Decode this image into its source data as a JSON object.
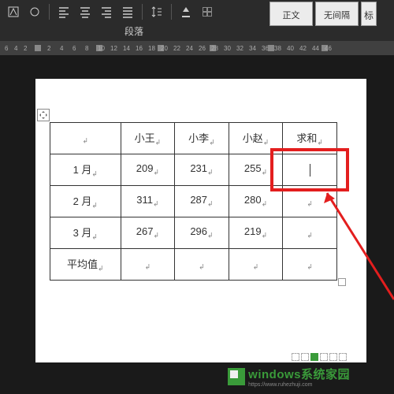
{
  "ribbon": {
    "section_label": "段落",
    "styles": {
      "normal": "正文",
      "no_spacing": "无间隔",
      "heading_partial": "标"
    }
  },
  "ruler": {
    "marks": [
      "6",
      "4",
      "2",
      "2",
      "4",
      "6",
      "8",
      "10",
      "12",
      "14",
      "16",
      "18",
      "20",
      "22",
      "24",
      "26",
      "28",
      "30",
      "32",
      "34",
      "36",
      "38",
      "40",
      "42",
      "44",
      "46"
    ]
  },
  "table": {
    "headers": [
      "",
      "小王",
      "小李",
      "小赵",
      "求和"
    ],
    "rows": [
      {
        "label": "1 月",
        "cells": [
          "209",
          "231",
          "255",
          ""
        ]
      },
      {
        "label": "2 月",
        "cells": [
          "311",
          "287",
          "280",
          ""
        ]
      },
      {
        "label": "3 月",
        "cells": [
          "267",
          "296",
          "219",
          ""
        ]
      },
      {
        "label": "平均值",
        "cells": [
          "",
          "",
          "",
          ""
        ]
      }
    ]
  },
  "watermark": {
    "main": "windows系统家园",
    "sub": "https://www.ruhezhuji.com"
  }
}
